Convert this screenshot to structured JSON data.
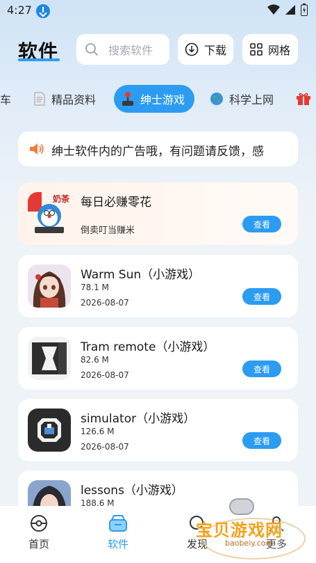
{
  "status_bar": {
    "time": "4:27"
  },
  "header": {
    "title": "软件",
    "search_placeholder": "搜索软件",
    "download_label": "下载",
    "grid_label": "网格"
  },
  "tabs": [
    {
      "label": "神车",
      "icon": "car-icon"
    },
    {
      "label": "精品资料",
      "icon": "document-icon"
    },
    {
      "label": "绅士游戏",
      "icon": "joystick-icon",
      "active": true
    },
    {
      "label": "科学上网",
      "icon": "globe-icon"
    },
    {
      "label": "",
      "icon": "gift-icon"
    }
  ],
  "notice": {
    "icon": "speaker-icon",
    "text": "绅士软件内的广告哦，有问题请反馈，感"
  },
  "items": [
    {
      "name": "每日必赚零花",
      "subtitle": "倒卖叮当赚米",
      "button": "查看",
      "ad": true,
      "icon_text": "奶茶"
    },
    {
      "name": "Warm Sun（小游戏）",
      "size": "78.1 M",
      "date": "2026-08-07",
      "button": "查看"
    },
    {
      "name": "Tram remote（小游戏）",
      "size": "82.6 M",
      "date": "2026-08-07",
      "button": "查看"
    },
    {
      "name": "simulator（小游戏）",
      "size": "126.6 M",
      "date": "2026-08-07",
      "button": "查看"
    },
    {
      "name": "lessons（小游戏）",
      "size": "188.6 M"
    }
  ],
  "bottom_nav": [
    {
      "label": "首页",
      "icon": "pokeball-icon"
    },
    {
      "label": "软件",
      "icon": "box-icon",
      "active": true
    },
    {
      "label": "发现",
      "icon": "discover-icon"
    },
    {
      "label": "更多",
      "icon": "user-icon"
    }
  ],
  "watermark": {
    "title": "宝贝游戏网",
    "url": "baobeiy.com"
  },
  "colors": {
    "accent": "#2b9cf2",
    "background": "#eef3f8"
  }
}
